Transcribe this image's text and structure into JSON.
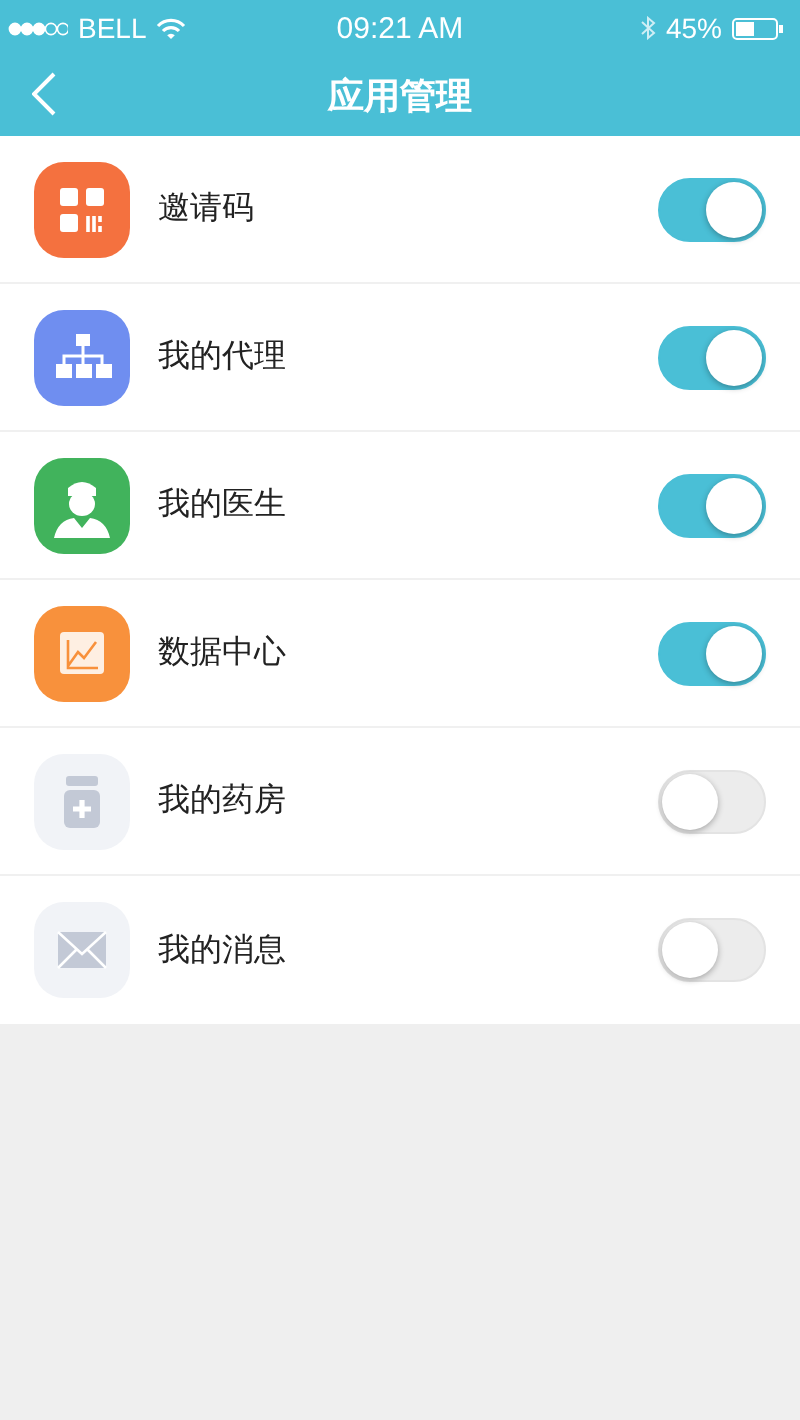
{
  "status_bar": {
    "carrier": "BELL",
    "time": "09:21 AM",
    "battery": "45%"
  },
  "nav_bar": {
    "title": "应用管理"
  },
  "apps": [
    {
      "kind": "qr",
      "label": "邀请码",
      "on": true
    },
    {
      "kind": "org",
      "label": "我的代理",
      "on": true
    },
    {
      "kind": "doctor",
      "label": "我的医生",
      "on": true
    },
    {
      "kind": "chart",
      "label": "数据中心",
      "on": true
    },
    {
      "kind": "medicine",
      "label": "我的药房",
      "on": false
    },
    {
      "kind": "mail",
      "label": "我的消息",
      "on": false
    }
  ]
}
